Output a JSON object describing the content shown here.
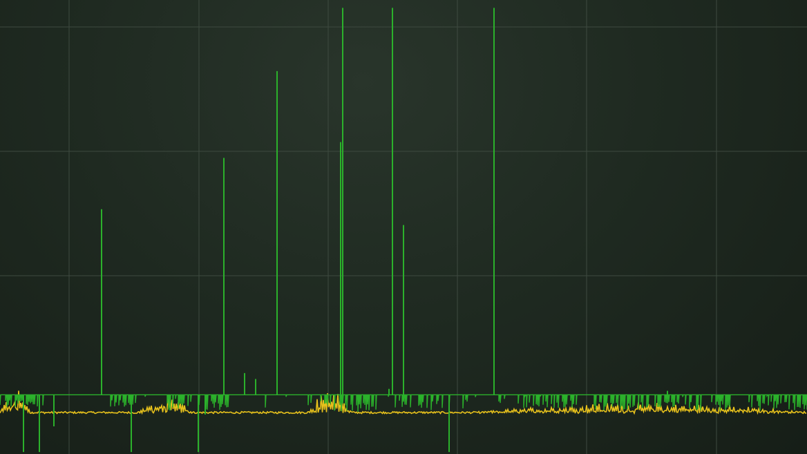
{
  "chart_data": {
    "type": "line",
    "title": "",
    "xlabel": "",
    "ylabel": "",
    "grid": true,
    "legend": "none",
    "grid_divisions": {
      "x": 6,
      "y": 3
    },
    "xlim": [
      0,
      1168
    ],
    "ylim": [
      -1.5,
      10
    ],
    "series": [
      {
        "color": "#2bb12b",
        "baseline": 0,
        "spikes": [
          {
            "x": 147,
            "y": 4.7
          },
          {
            "x": 324,
            "y": 6.0
          },
          {
            "x": 354,
            "y": 0.55
          },
          {
            "x": 370,
            "y": 0.4
          },
          {
            "x": 401,
            "y": 8.2
          },
          {
            "x": 493,
            "y": 6.4
          },
          {
            "x": 496,
            "y": 9.8
          },
          {
            "x": 563,
            "y": 0.15
          },
          {
            "x": 568,
            "y": 9.8
          },
          {
            "x": 584,
            "y": 4.3
          },
          {
            "x": 715,
            "y": 9.8
          },
          {
            "x": 966,
            "y": 0.1
          }
        ],
        "dips": [
          {
            "x": 34,
            "y": -1.45
          },
          {
            "x": 57,
            "y": -1.45
          },
          {
            "x": 78,
            "y": -0.8
          },
          {
            "x": 190,
            "y": -1.45
          },
          {
            "x": 287,
            "y": -1.45
          },
          {
            "x": 297,
            "y": -0.5
          },
          {
            "x": 650,
            "y": -1.45
          }
        ],
        "dense_regions": [
          {
            "start": 0,
            "end": 60,
            "depth": 0.35
          },
          {
            "start": 160,
            "end": 200,
            "depth": 0.3
          },
          {
            "start": 240,
            "end": 330,
            "depth": 0.4
          },
          {
            "start": 470,
            "end": 545,
            "depth": 0.45
          },
          {
            "start": 585,
            "end": 640,
            "depth": 0.4
          },
          {
            "start": 750,
            "end": 830,
            "depth": 0.35
          },
          {
            "start": 860,
            "end": 1060,
            "depth": 0.4
          },
          {
            "start": 1080,
            "end": 1168,
            "depth": 0.4
          }
        ]
      },
      {
        "color": "#e8c21c",
        "baseline": -0.45,
        "bumps": [
          {
            "start": 0,
            "end": 45,
            "height": 0.6
          },
          {
            "start": 200,
            "end": 280,
            "height": 0.4
          },
          {
            "start": 445,
            "end": 510,
            "height": 0.55
          },
          {
            "start": 690,
            "end": 1168,
            "height": 0.25
          }
        ]
      }
    ]
  }
}
